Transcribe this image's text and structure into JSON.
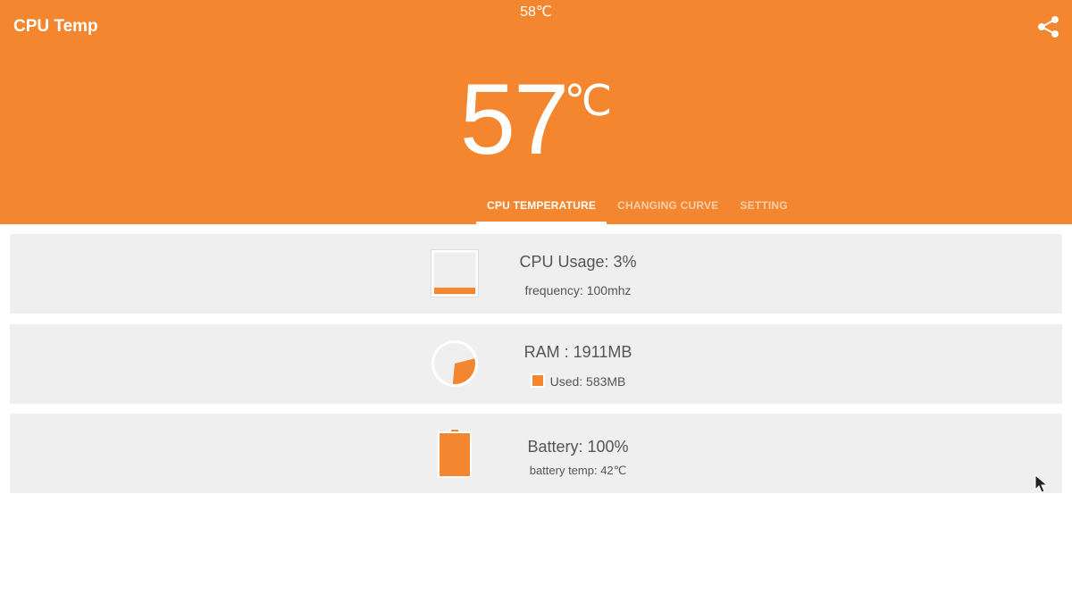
{
  "status_bar": {
    "temperature": "58℃"
  },
  "app": {
    "title": "CPU Temp",
    "share_icon": "share-icon"
  },
  "hero": {
    "value": "57",
    "unit": "℃"
  },
  "tabs": [
    {
      "label": "CPU TEMPERATURE",
      "active": true
    },
    {
      "label": "CHANGING CURVE",
      "active": false
    },
    {
      "label": "SETTING",
      "active": false
    }
  ],
  "cards": {
    "cpu": {
      "title": "CPU Usage: 3%",
      "subtitle": "frequency: 100mhz",
      "usage_fraction": 0.03,
      "icon": "cpu-usage-icon"
    },
    "ram": {
      "title": "RAM : 1911MB",
      "subtitle": "Used: 583MB",
      "used_fraction": 0.305,
      "icon": "ram-pie-icon"
    },
    "battery": {
      "title": "Battery: 100%",
      "subtitle": "battery temp: 42℃",
      "level_fraction": 1.0,
      "icon": "battery-icon"
    }
  },
  "colors": {
    "accent": "#f3862f",
    "card_bg": "#efefef",
    "text": "#555555",
    "white": "#ffffff"
  }
}
